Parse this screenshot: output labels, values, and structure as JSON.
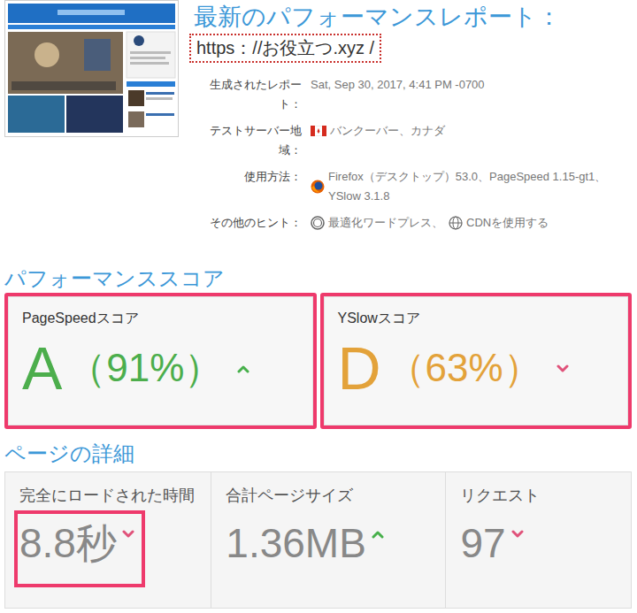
{
  "report": {
    "title": "最新のパフォーマンスレポート：",
    "url": "https：//お役立つ.xyz /",
    "url_highlighted": true,
    "info": [
      {
        "label": "生成されたレポート：",
        "values": [
          "Sat, Sep 30, 2017, 4:41 PM -0700"
        ]
      },
      {
        "label": "テストサーバー地域：",
        "values": [
          "バンクーバー、カナダ"
        ]
      },
      {
        "label": "使用方法：",
        "values": [
          "Firefox（デスクトップ）53.0、PageSpeed 1.15-gt1、YSlow 3.1.8"
        ]
      },
      {
        "label": "その他のヒント：",
        "values": [
          "最適化ワードプレス、",
          "CDNを使用する"
        ]
      }
    ]
  },
  "scores": {
    "heading": "パフォーマンススコア",
    "items": [
      {
        "label": "PageSpeedスコア",
        "grade": "A",
        "percent": "（91%）",
        "trend": "up",
        "color": "#4cae4c",
        "highlighted": true
      },
      {
        "label": "YSlowスコア",
        "grade": "D",
        "percent": "（63%）",
        "trend": "down",
        "color": "#e3a23a",
        "highlighted": true
      }
    ]
  },
  "details": {
    "heading": "ページの詳細",
    "items": [
      {
        "label": "完全にロードされた時間",
        "value": "8.8秒",
        "trend": "down",
        "highlighted": true
      },
      {
        "label": "合計ページサイズ",
        "value": "1.36MB",
        "trend": "up",
        "highlighted": false
      },
      {
        "label": "リクエスト",
        "value": "97",
        "trend": "down",
        "highlighted": false
      }
    ]
  }
}
